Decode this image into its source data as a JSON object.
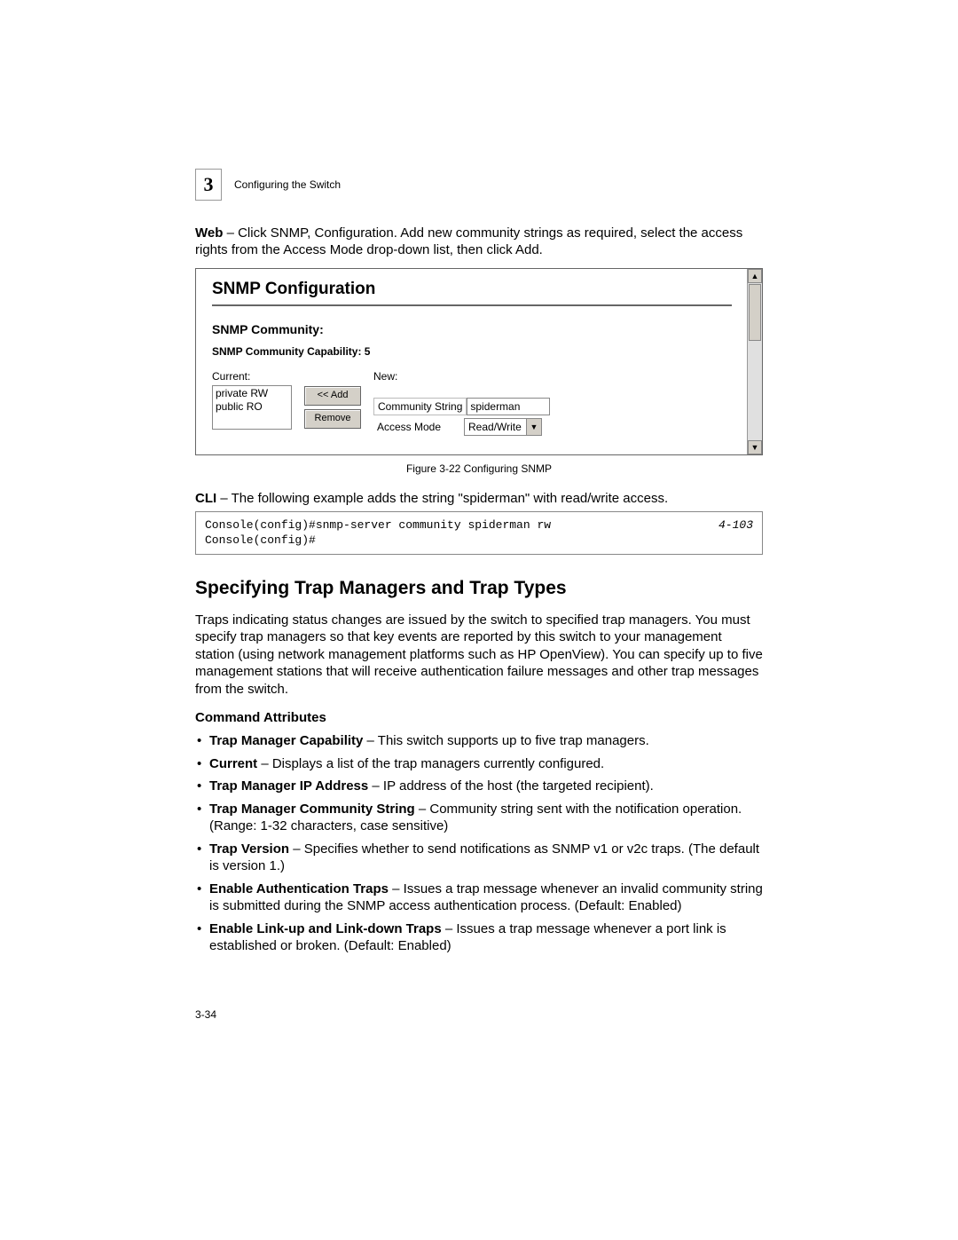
{
  "header": {
    "chapter": "3",
    "title": "Configuring the Switch"
  },
  "intro": {
    "label": "Web",
    "text": " – Click SNMP, Configuration. Add new community strings as required, select the access rights from the Access Mode drop-down list, then click Add."
  },
  "snmp": {
    "title": "SNMP Configuration",
    "subtitle": "SNMP Community:",
    "capability": "SNMP Community Capability: 5",
    "current_label": "Current:",
    "current_items": [
      "private RW",
      "public RO"
    ],
    "new_label": "New:",
    "add_btn": "<< Add",
    "remove_btn": "Remove",
    "cs_label": "Community String",
    "cs_value": "spiderman",
    "am_label": "Access Mode",
    "am_value": "Read/Write"
  },
  "caption": "Figure 3-22  Configuring SNMP",
  "cli": {
    "label": "CLI",
    "text": " – The following example adds the string \"spiderman\" with read/write access.",
    "code": "Console(config)#snmp-server community spiderman rw\nConsole(config)#",
    "ref": "4-103"
  },
  "section_title": "Specifying Trap Managers and Trap Types",
  "section_body": "Traps indicating status changes are issued by the switch to specified trap managers. You must specify trap managers so that key events are reported by this switch to your management station (using network management platforms such as HP OpenView). You can specify up to five management stations that will receive authentication failure messages and other trap messages from the switch.",
  "attr_head": "Command Attributes",
  "attrs": [
    {
      "b": "Trap Manager Capability",
      "t": " – This switch supports up to five trap managers."
    },
    {
      "b": "Current",
      "t": " – Displays a list of the trap managers currently configured."
    },
    {
      "b": "Trap Manager IP Address",
      "t": " – IP address of the host (the targeted recipient)."
    },
    {
      "b": "Trap Manager Community String",
      "t": " – Community string sent with the notification operation. (Range: 1-32 characters, case sensitive)"
    },
    {
      "b": "Trap Version",
      "t": " – Specifies whether to send notifications as SNMP v1 or v2c traps. (The default is version 1.)"
    },
    {
      "b": "Enable Authentication Traps",
      "t": " – Issues a trap message whenever an invalid community string is submitted during the SNMP access authentication process. (Default: Enabled)"
    },
    {
      "b": "Enable Link-up and Link-down Traps",
      "t": " – Issues a trap message whenever a port link is established or broken. (Default: Enabled)"
    }
  ],
  "page_num": "3-34"
}
